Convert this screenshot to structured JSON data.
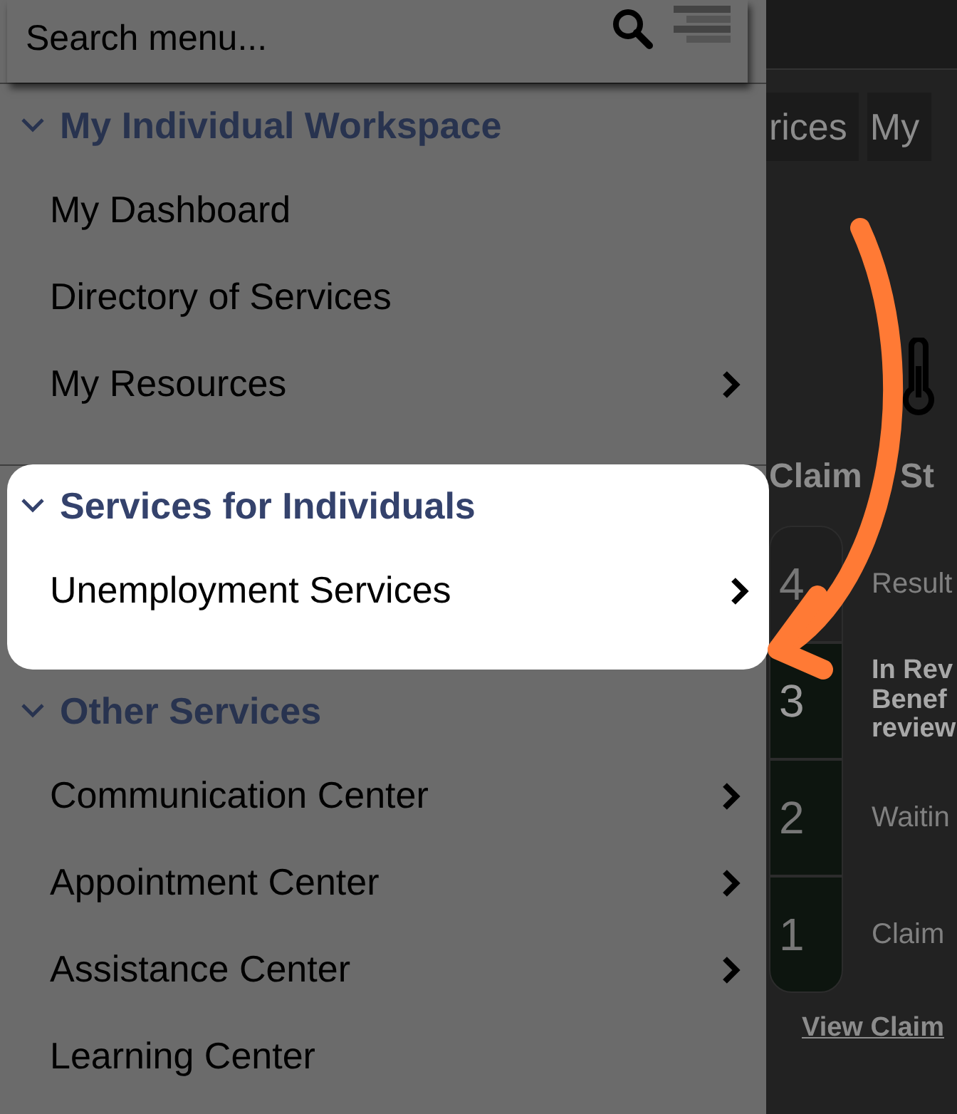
{
  "search": {
    "placeholder": "Search menu..."
  },
  "menu_sections": [
    {
      "title": "My Individual Workspace",
      "expanded": true,
      "highlighted": false,
      "items": [
        {
          "label": "My Dashboard",
          "has_submenu": false
        },
        {
          "label": "Directory of Services",
          "has_submenu": false
        },
        {
          "label": "My Resources",
          "has_submenu": true
        }
      ]
    },
    {
      "title": "Services for Individuals",
      "expanded": true,
      "highlighted": true,
      "items": [
        {
          "label": "Unemployment Services",
          "has_submenu": true
        }
      ]
    },
    {
      "title": "Other Services",
      "expanded": true,
      "highlighted": false,
      "items": [
        {
          "label": "Communication Center",
          "has_submenu": true
        },
        {
          "label": "Appointment Center",
          "has_submenu": true
        },
        {
          "label": "Assistance Center",
          "has_submenu": true
        },
        {
          "label": "Learning Center",
          "has_submenu": false
        }
      ]
    }
  ],
  "background_page": {
    "tabs": [
      "rices",
      "My"
    ],
    "heading": "Claim St",
    "steps": [
      {
        "number": "4",
        "label": [
          "Result"
        ],
        "reached": false,
        "current": false
      },
      {
        "number": "3",
        "label": [
          "In Rev",
          "Benef",
          "review"
        ],
        "reached": true,
        "current": true
      },
      {
        "number": "2",
        "label": [
          "Waitin"
        ],
        "reached": true,
        "current": false
      },
      {
        "number": "1",
        "label": [
          "Claim"
        ],
        "reached": true,
        "current": false
      }
    ],
    "link": "View Claim"
  }
}
